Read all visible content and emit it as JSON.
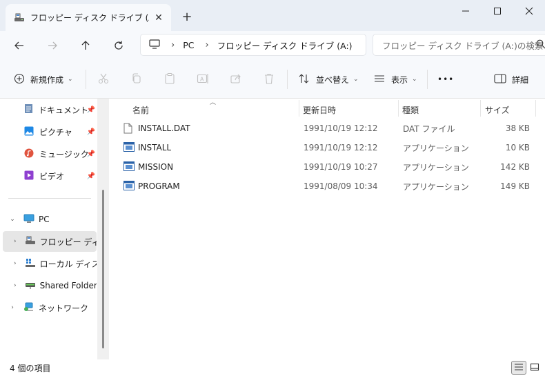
{
  "window": {
    "tab_title": "フロッピー ディスク ドライブ (A:)",
    "close_tab": "✕",
    "new_tab": "+"
  },
  "address": {
    "crumbs": [
      "PC",
      "フロッピー ディスク ドライブ (A:)"
    ],
    "search_placeholder": "フロッピー ディスク ドライブ (A:)の検索"
  },
  "commands": {
    "new": "新規作成",
    "sort": "並べ替え",
    "view": "表示",
    "more": "•••",
    "details": "詳細"
  },
  "sidebar": {
    "quick": [
      {
        "label": "ドキュメント"
      },
      {
        "label": "ピクチャ"
      },
      {
        "label": "ミュージック"
      },
      {
        "label": "ビデオ"
      }
    ],
    "pc": "PC",
    "drives": [
      {
        "label": "フロッピー ディスク ドライブ (A:)"
      },
      {
        "label": "ローカル ディスク (C:)"
      },
      {
        "label": "Shared Folders"
      }
    ],
    "network": "ネットワーク"
  },
  "columns": {
    "name": "名前",
    "date": "更新日時",
    "type": "種類",
    "size": "サイズ"
  },
  "files": [
    {
      "name": "INSTALL.DAT",
      "date": "1991/10/19 12:12",
      "type": "DAT ファイル",
      "size": "38 KB",
      "icon": "file-icon"
    },
    {
      "name": "INSTALL",
      "date": "1991/10/19 12:12",
      "type": "アプリケーション",
      "size": "10 KB",
      "icon": "app-icon"
    },
    {
      "name": "MISSION",
      "date": "1991/10/19 10:27",
      "type": "アプリケーション",
      "size": "142 KB",
      "icon": "app-icon"
    },
    {
      "name": "PROGRAM",
      "date": "1991/08/09 10:34",
      "type": "アプリケーション",
      "size": "149 KB",
      "icon": "app-icon"
    }
  ],
  "status": {
    "count": "4 個の項目"
  },
  "colors": {
    "accent": "#0067c0",
    "titlebar": "#e9eef5",
    "toolbar": "#f7f9fc"
  }
}
